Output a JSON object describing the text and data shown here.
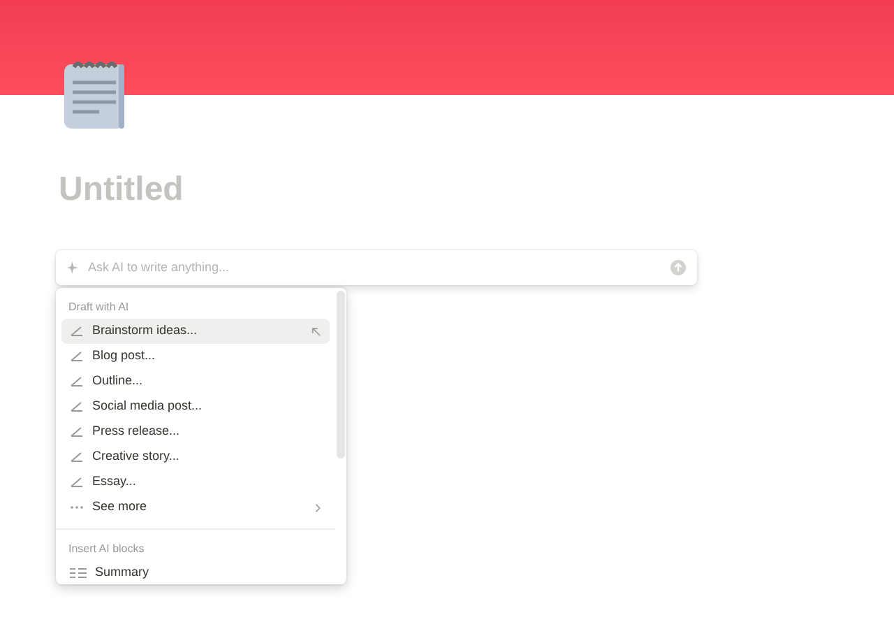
{
  "page": {
    "title": "Untitled"
  },
  "ai_input": {
    "placeholder": "Ask AI to write anything..."
  },
  "menu": {
    "sections": [
      {
        "heading": "Draft with AI",
        "items": [
          {
            "label": "Brainstorm ideas...",
            "kind": "draft",
            "selected": true
          },
          {
            "label": "Blog post...",
            "kind": "draft",
            "selected": false
          },
          {
            "label": "Outline...",
            "kind": "draft",
            "selected": false
          },
          {
            "label": "Social media post...",
            "kind": "draft",
            "selected": false
          },
          {
            "label": "Press release...",
            "kind": "draft",
            "selected": false
          },
          {
            "label": "Creative story...",
            "kind": "draft",
            "selected": false
          },
          {
            "label": "Essay...",
            "kind": "draft",
            "selected": false
          },
          {
            "label": "See more",
            "kind": "more",
            "selected": false
          }
        ]
      },
      {
        "heading": "Insert AI blocks",
        "items": [
          {
            "label": "Summary",
            "kind": "block",
            "selected": false
          }
        ]
      }
    ]
  }
}
